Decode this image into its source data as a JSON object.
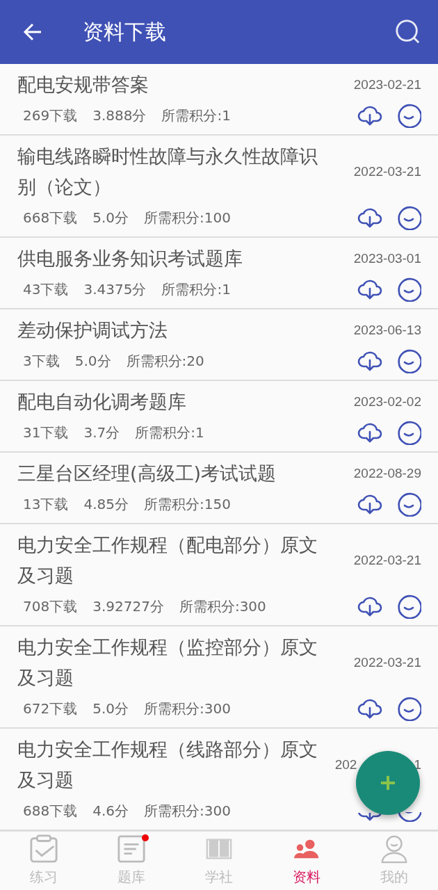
{
  "header": {
    "title": "资料下载"
  },
  "items": [
    {
      "title": "配电安规带答案",
      "date": "2023-02-21",
      "downloads": "269下载",
      "score": "3.888分",
      "points": "所需积分:1"
    },
    {
      "title": "输电线路瞬时性故障与永久性故障识别（论文）",
      "date": "2022-03-21",
      "downloads": "668下载",
      "score": "5.0分",
      "points": "所需积分:100"
    },
    {
      "title": "供电服务业务知识考试题库",
      "date": "2023-03-01",
      "downloads": "43下载",
      "score": "3.4375分",
      "points": "所需积分:1"
    },
    {
      "title": "差动保护调试方法",
      "date": "2023-06-13",
      "downloads": "3下载",
      "score": "5.0分",
      "points": "所需积分:20"
    },
    {
      "title": "配电自动化调考题库",
      "date": "2023-02-02",
      "downloads": "31下载",
      "score": "3.7分",
      "points": "所需积分:1"
    },
    {
      "title": "三星台区经理(高级工)考试试题",
      "date": "2022-08-29",
      "downloads": "13下载",
      "score": "4.85分",
      "points": "所需积分:150"
    },
    {
      "title": "电力安全工作规程（配电部分）原文及习题",
      "date": "2022-03-21",
      "downloads": "708下载",
      "score": "3.92727分",
      "points": "所需积分:300"
    },
    {
      "title": "电力安全工作规程（监控部分）原文及习题",
      "date": "2022-03-21",
      "downloads": "672下载",
      "score": "5.0分",
      "points": "所需积分:300"
    },
    {
      "title": "电力安全工作规程（线路部分）原文及习题",
      "date": "202",
      "date_tail": "1",
      "downloads": "688下载",
      "score": "4.6分",
      "points": "所需积分:300"
    }
  ],
  "nav": [
    {
      "label": "练习",
      "selected": false,
      "badge": false
    },
    {
      "label": "题库",
      "selected": false,
      "badge": true
    },
    {
      "label": "学社",
      "selected": false,
      "badge": false
    },
    {
      "label": "资料",
      "selected": true,
      "badge": false
    },
    {
      "label": "我的",
      "selected": false,
      "badge": false
    }
  ]
}
